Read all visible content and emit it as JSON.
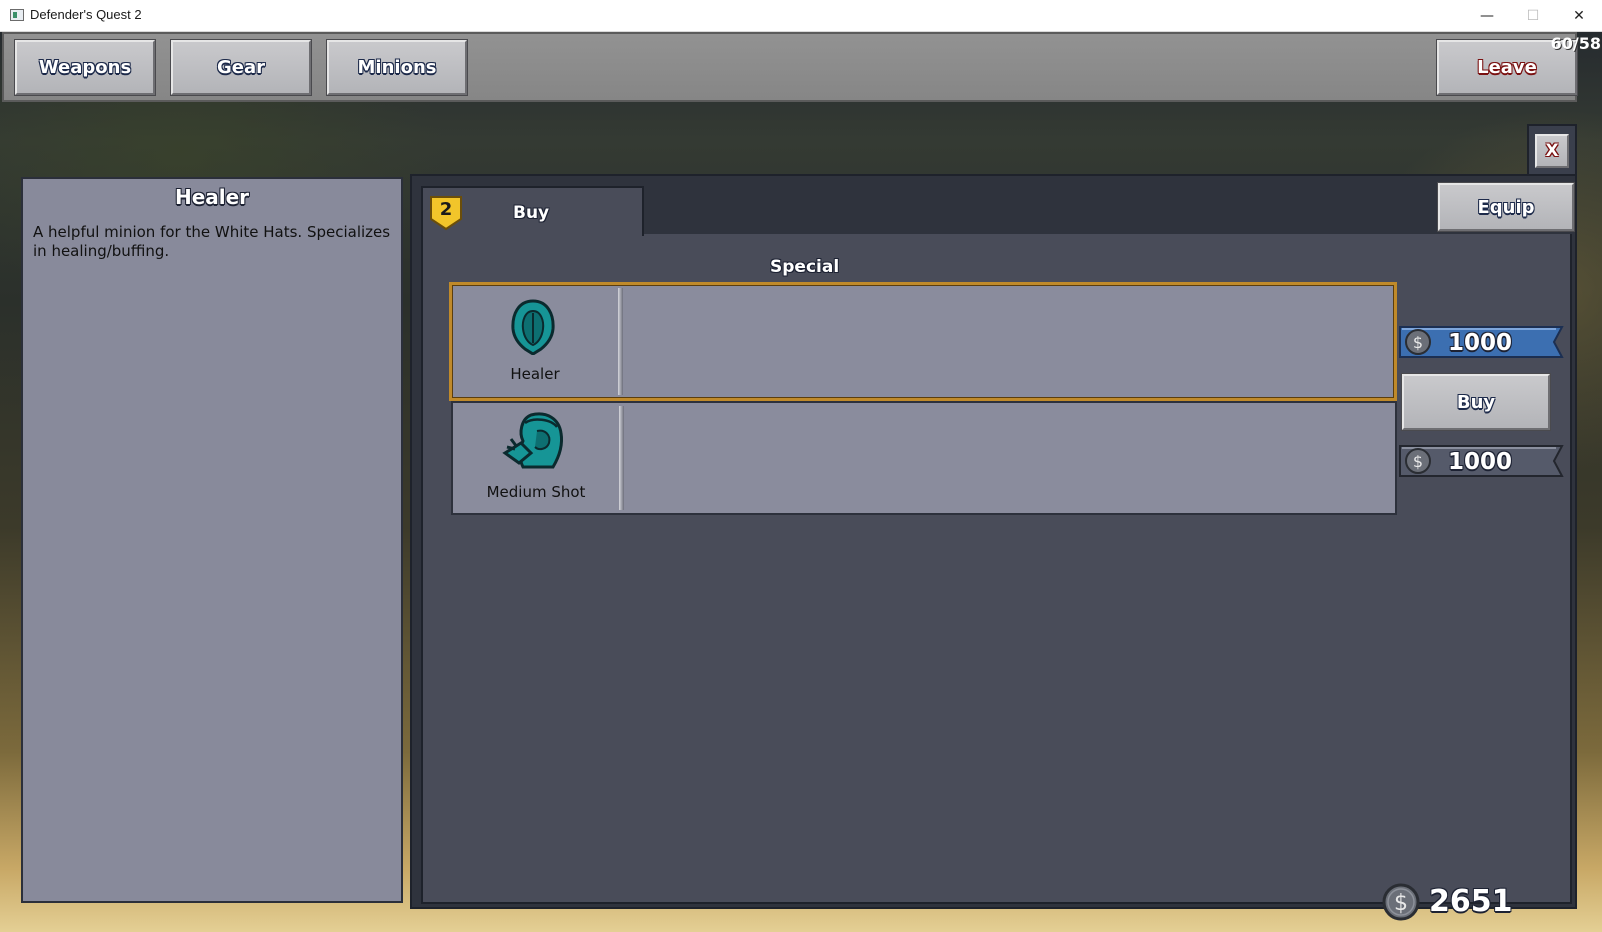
{
  "window": {
    "title": "Defender's Quest 2",
    "minimize": "—",
    "maximize": "☐",
    "close": "✕"
  },
  "topbar": {
    "tabs": [
      {
        "label": "Weapons"
      },
      {
        "label": "Gear"
      },
      {
        "label": "Minions"
      }
    ],
    "leave_label": "Leave",
    "counter": "60/58"
  },
  "info": {
    "title": "Healer",
    "description": "A helpful minion for the White Hats. Specializes in healing/buffing."
  },
  "shop": {
    "close_label": "X",
    "tab_label": "Buy",
    "badge": "2",
    "equip_label": "Equip",
    "category": "Special",
    "items": [
      {
        "name": "Healer",
        "price": "1000",
        "icon": "healer-hood-icon",
        "selected": true
      },
      {
        "name": "Medium Shot",
        "price": "1000",
        "icon": "medium-shot-icon",
        "selected": false
      }
    ],
    "buy_label": "Buy",
    "money": "2651"
  },
  "colors": {
    "accent_gold": "#c08a2a",
    "minion_teal": "#169596",
    "price_blue": "#3c6fb1",
    "price_grey": "#555a6a"
  }
}
